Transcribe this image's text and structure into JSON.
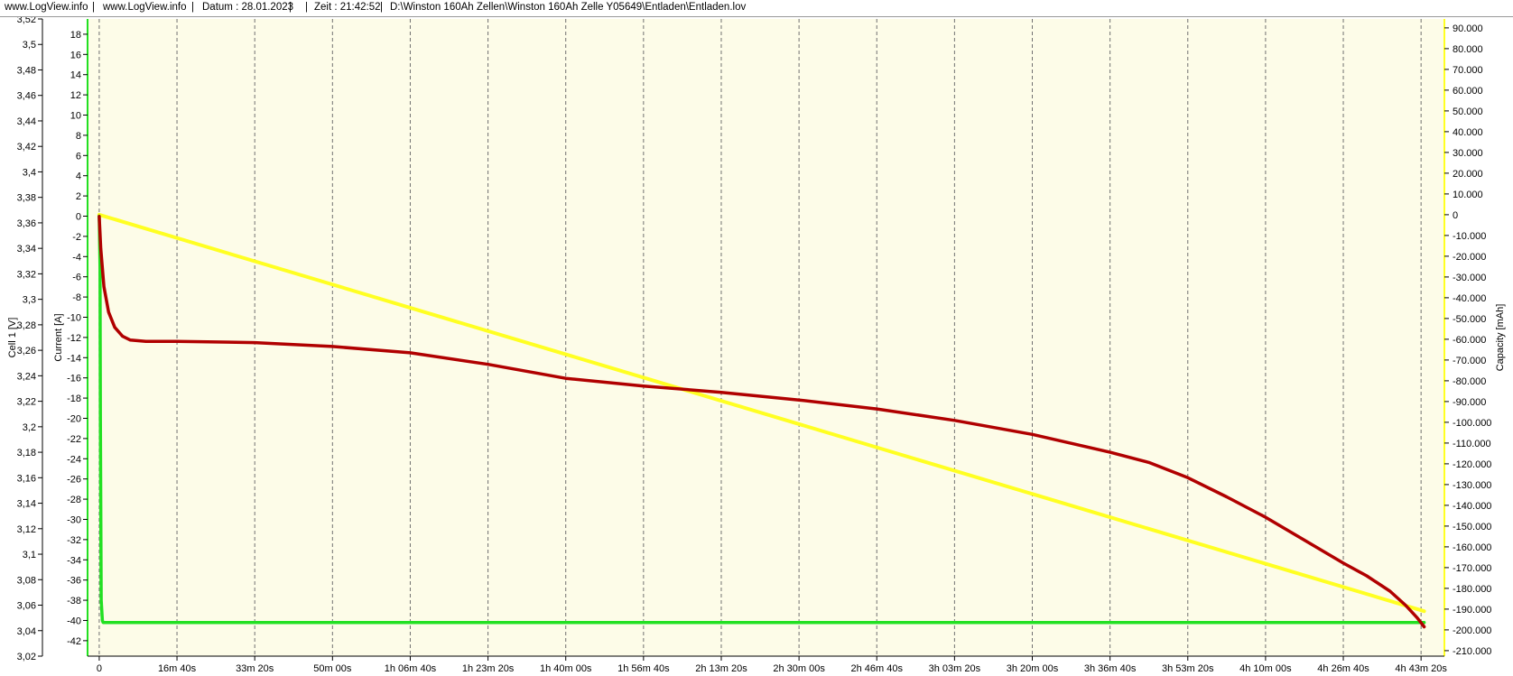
{
  "header": {
    "site1": "www.LogView.info",
    "site2": "www.LogView.info",
    "date": "Datum : 28.01.2023",
    "time": "Zeit : 21:42:52",
    "path": "D:\\Winston 160Ah Zellen\\Winston 160Ah Zelle Y05649\\Entladen\\Entladen.lov",
    "sep": "|"
  },
  "colors": {
    "plot_bg": "#fdfce8",
    "voltage": "#b00000",
    "current": "#22e022",
    "capacity": "#ffff22",
    "current_axis": "#22e022",
    "capacity_axis": "#ffff22"
  },
  "chart_data": {
    "type": "line",
    "xlabel": "",
    "x_ticks": [
      "0",
      "16m 40s",
      "33m 20s",
      "50m 00s",
      "1h 06m 40s",
      "1h 23m 20s",
      "1h 40m 00s",
      "1h 56m 40s",
      "2h 13m 20s",
      "2h 30m 00s",
      "2h 46m 40s",
      "3h 03m 20s",
      "3h 20m 00s",
      "3h 36m 40s",
      "3h 53m 20s",
      "4h 10m 00s",
      "4h 26m 40s",
      "4h 43m 20s"
    ],
    "x_unit": "s",
    "x_range": [
      -150,
      17300
    ],
    "axes": {
      "voltage": {
        "label": "Cell 1 [V]",
        "range": [
          3.02,
          3.52
        ],
        "ticks": [
          "3,52",
          "3,5",
          "3,48",
          "3,46",
          "3,44",
          "3,42",
          "3,4",
          "3,38",
          "3,36",
          "3,34",
          "3,32",
          "3,3",
          "3,28",
          "3,26",
          "3,24",
          "3,22",
          "3,2",
          "3,18",
          "3,16",
          "3,14",
          "3,12",
          "3,1",
          "3,08",
          "3,06",
          "3,04",
          "3,02"
        ]
      },
      "current": {
        "label": "Current [A]",
        "range": [
          -43.53,
          19.51
        ],
        "ticks": [
          "18",
          "16",
          "14",
          "12",
          "10",
          "8",
          "6",
          "4",
          "2",
          "0",
          "-2",
          "-4",
          "-6",
          "-8",
          "-10",
          "-12",
          "-14",
          "-16",
          "-18",
          "-20",
          "-22",
          "-24",
          "-26",
          "-28",
          "-30",
          "-32",
          "-34",
          "-36",
          "-38",
          "-40",
          "-42"
        ]
      },
      "capacity": {
        "label": "Capacity [mAh]",
        "range": [
          -212650,
          94300
        ],
        "ticks": [
          "90.000",
          "80.000",
          "70.000",
          "60.000",
          "50.000",
          "40.000",
          "30.000",
          "20.000",
          "10.000",
          "0",
          "-10.000",
          "-20.000",
          "-30.000",
          "-40.000",
          "-50.000",
          "-60.000",
          "-70.000",
          "-80.000",
          "-90.000",
          "-100.000",
          "-110.000",
          "-120.000",
          "-130.000",
          "-140.000",
          "-150.000",
          "-160.000",
          "-170.000",
          "-180.000",
          "-190.000",
          "-200.000",
          "-210.000"
        ]
      }
    },
    "series": [
      {
        "name": "Cell 1 [V]",
        "axis": "voltage",
        "x": [
          0,
          20,
          60,
          120,
          200,
          300,
          400,
          600,
          1000,
          2000,
          3000,
          4000,
          5000,
          6000,
          7000,
          8000,
          9000,
          10000,
          11000,
          12000,
          13000,
          13500,
          14000,
          14500,
          15000,
          15500,
          16000,
          16300,
          16600,
          16800,
          16950,
          17040
        ],
        "y": [
          3.365,
          3.34,
          3.31,
          3.29,
          3.278,
          3.271,
          3.268,
          3.267,
          3.267,
          3.266,
          3.263,
          3.258,
          3.249,
          3.238,
          3.232,
          3.227,
          3.221,
          3.214,
          3.205,
          3.194,
          3.18,
          3.172,
          3.16,
          3.145,
          3.129,
          3.111,
          3.093,
          3.083,
          3.071,
          3.06,
          3.05,
          3.043
        ]
      },
      {
        "name": "Current [A]",
        "axis": "current",
        "x": [
          0,
          10,
          15,
          25,
          40,
          50,
          17040
        ],
        "y": [
          0,
          -5,
          -20,
          -38,
          -40,
          -40.2,
          -40.2
        ]
      },
      {
        "name": "Capacity [mAh]",
        "axis": "capacity",
        "x": [
          0,
          17040
        ],
        "y": [
          0,
          -191000
        ]
      }
    ],
    "grid": "vertical",
    "legend": "none"
  }
}
